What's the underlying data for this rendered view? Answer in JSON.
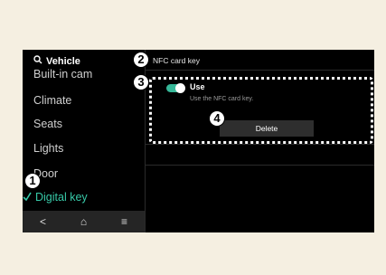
{
  "sidebar": {
    "header": "Vehicle",
    "items": [
      {
        "label": "Built-in cam"
      },
      {
        "label": "Climate"
      },
      {
        "label": "Seats"
      },
      {
        "label": "Lights"
      },
      {
        "label": "Door"
      },
      {
        "label": "Digital key",
        "selected": true
      }
    ]
  },
  "nav_bar": {
    "back": "<",
    "home": "⌂",
    "menu": "≡"
  },
  "panel": {
    "title": "NFC card key",
    "use": {
      "label": "Use",
      "description": "Use the NFC card key.",
      "enabled": true
    },
    "delete_label": "Delete"
  },
  "callouts": [
    "1",
    "2",
    "3",
    "4"
  ],
  "colors": {
    "accent": "#36b898",
    "selected_text": "#37c9a8",
    "background": "#000000",
    "page": "#f5efe1"
  }
}
